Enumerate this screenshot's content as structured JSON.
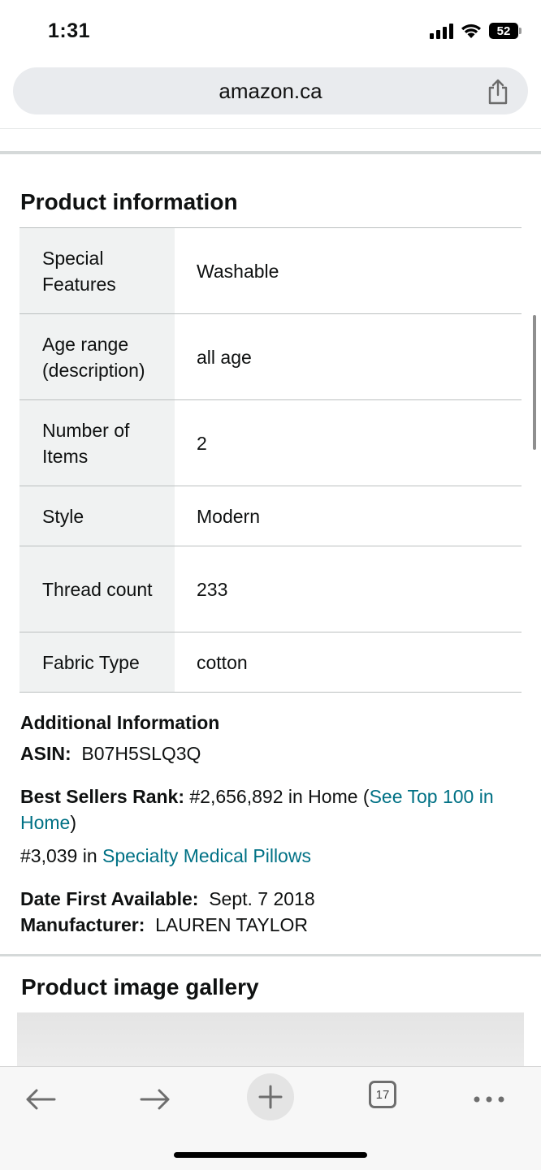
{
  "status": {
    "time": "1:31",
    "battery": "52"
  },
  "browser": {
    "url": "amazon.ca"
  },
  "product_info": {
    "title": "Product information",
    "rows": [
      {
        "label": "Special Features",
        "value": "Washable"
      },
      {
        "label": "Age range (description)",
        "value": "all age"
      },
      {
        "label": "Number of Items",
        "value": "2"
      },
      {
        "label": "Style",
        "value": "Modern"
      },
      {
        "label": "Thread count",
        "value": "233"
      },
      {
        "label": "Fabric Type",
        "value": "cotton"
      }
    ]
  },
  "additional": {
    "heading": "Additional Information",
    "asin_label": "ASIN:",
    "asin_value": "B07H5SLQ3Q",
    "bsr_label": "Best Sellers Rank:",
    "bsr_main": "#2,656,892 in Home (",
    "bsr_link": "See Top 100 in Home",
    "bsr_close": ")",
    "bsr_sub_prefix": "#3,039 in ",
    "bsr_sub_link": "Specialty Medical Pillows",
    "date_label": "Date First Available:",
    "date_value": "Sept. 7 2018",
    "manufacturer_label": "Manufacturer:",
    "manufacturer_value": "LAUREN TAYLOR"
  },
  "gallery": {
    "title": "Product image gallery"
  },
  "toolbar": {
    "tab_count": "17"
  },
  "colors": {
    "link": "#007185",
    "key_bg": "#f0f2f2"
  }
}
